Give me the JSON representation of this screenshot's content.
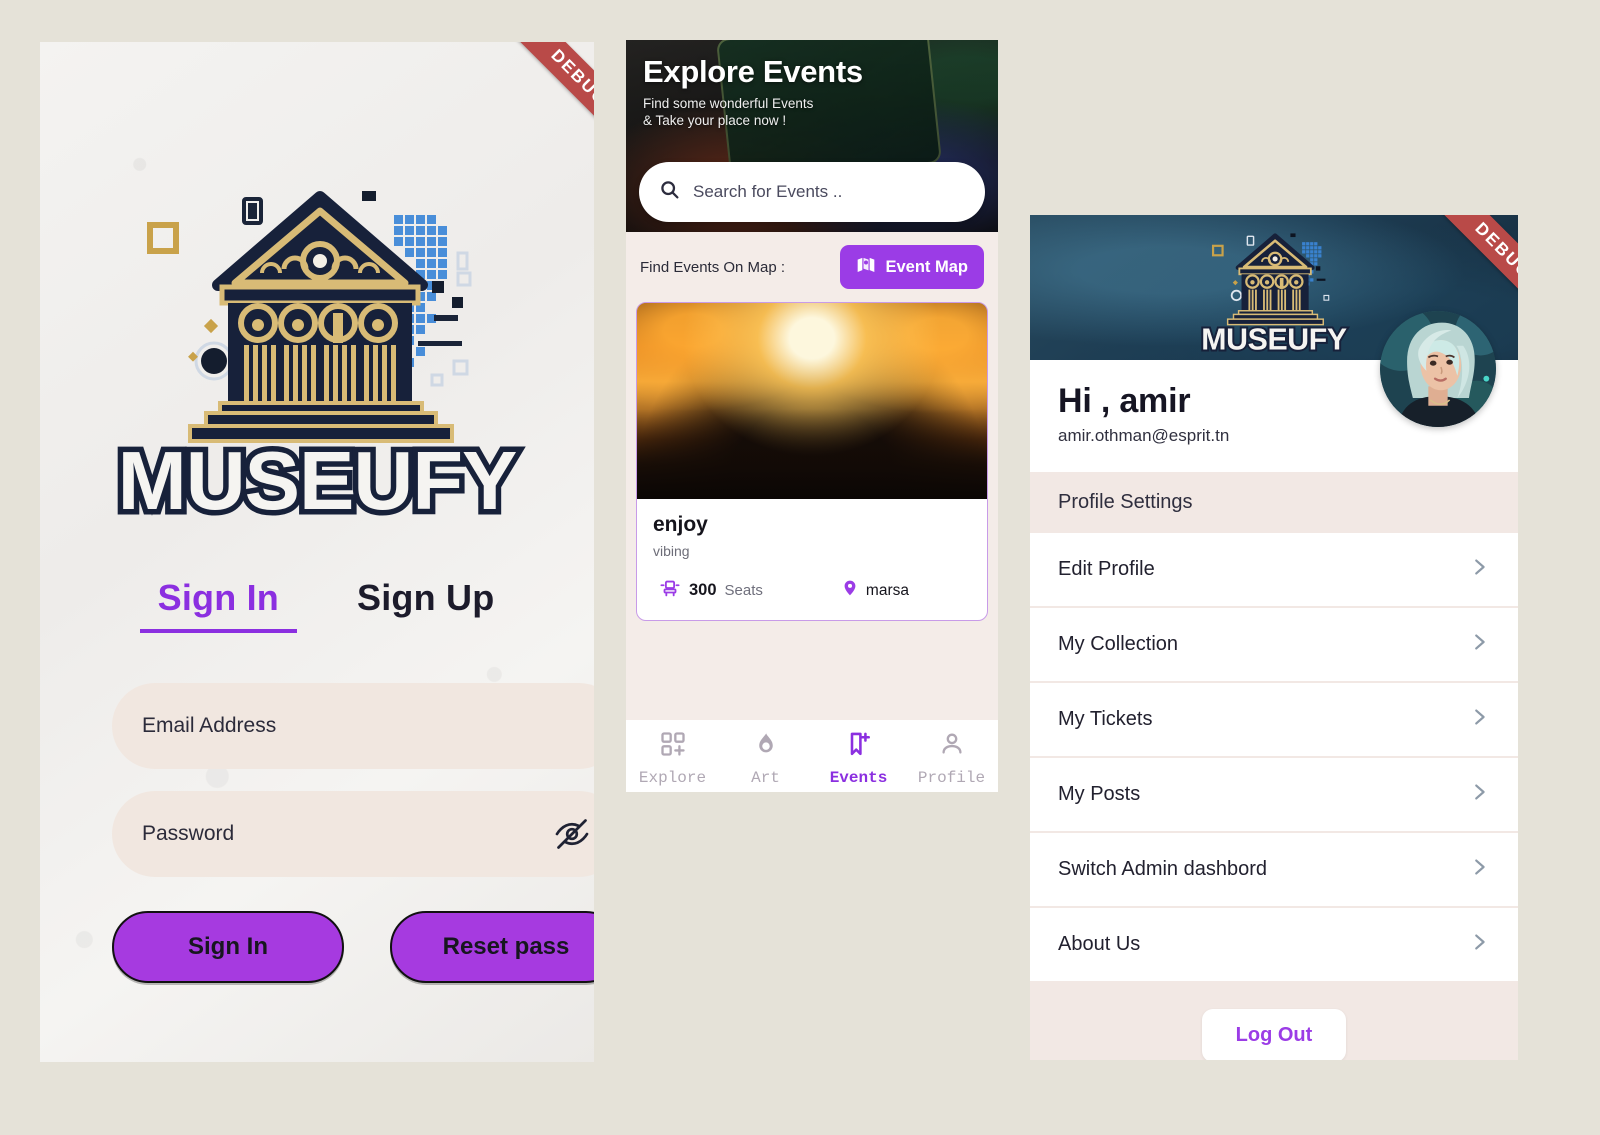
{
  "background_color": "#e5e2d8",
  "accent_purple": "#8b2fe0",
  "auth": {
    "debug_ribbon": "DEBUG",
    "logo_wordmark": "MUSEUFY",
    "tabs": [
      {
        "label": "Sign In",
        "active": true
      },
      {
        "label": "Sign Up",
        "active": false
      }
    ],
    "email": {
      "placeholder": "Email Address",
      "value": ""
    },
    "password": {
      "placeholder": "Password",
      "value": "",
      "toggle_icon": "eye-off-icon"
    },
    "buttons": {
      "sign_in": "Sign In",
      "reset_pass": "Reset pass"
    }
  },
  "events": {
    "header": {
      "title": "Explore Events",
      "subtitle_line1": "Find some wonderful Events",
      "subtitle_line2": "& Take your place now !"
    },
    "search": {
      "placeholder": "Search for Events ..",
      "value": "",
      "icon": "search-icon"
    },
    "map_row": {
      "label": "Find Events On Map :",
      "button_label": "Event Map",
      "button_icon": "map-icon"
    },
    "card": {
      "name": "enjoy",
      "description": "vibing",
      "seats_count": "300",
      "seats_label": "Seats",
      "seats_icon": "seat-icon",
      "location": "marsa",
      "location_icon": "pin-icon"
    },
    "bottom_nav": [
      {
        "label": "Explore",
        "icon": "grid-plus-icon",
        "active": false
      },
      {
        "label": "Art",
        "icon": "flame-icon",
        "active": false
      },
      {
        "label": "Events",
        "icon": "bookmark-plus-icon",
        "active": true
      },
      {
        "label": "Profile",
        "icon": "person-icon",
        "active": false
      }
    ]
  },
  "profile": {
    "debug_ribbon": "DEBUG",
    "banner_wordmark": "MUSEUFY",
    "avatar_alt": "user-avatar",
    "greeting": "Hi , amir",
    "email": "amir.othman@esprit.tn",
    "section_title": "Profile Settings",
    "menu": [
      {
        "label": "Edit Profile"
      },
      {
        "label": "My Collection"
      },
      {
        "label": "My Tickets"
      },
      {
        "label": "My Posts"
      },
      {
        "label": "Switch Admin dashbord"
      },
      {
        "label": "About Us"
      }
    ],
    "logout_label": "Log Out"
  }
}
